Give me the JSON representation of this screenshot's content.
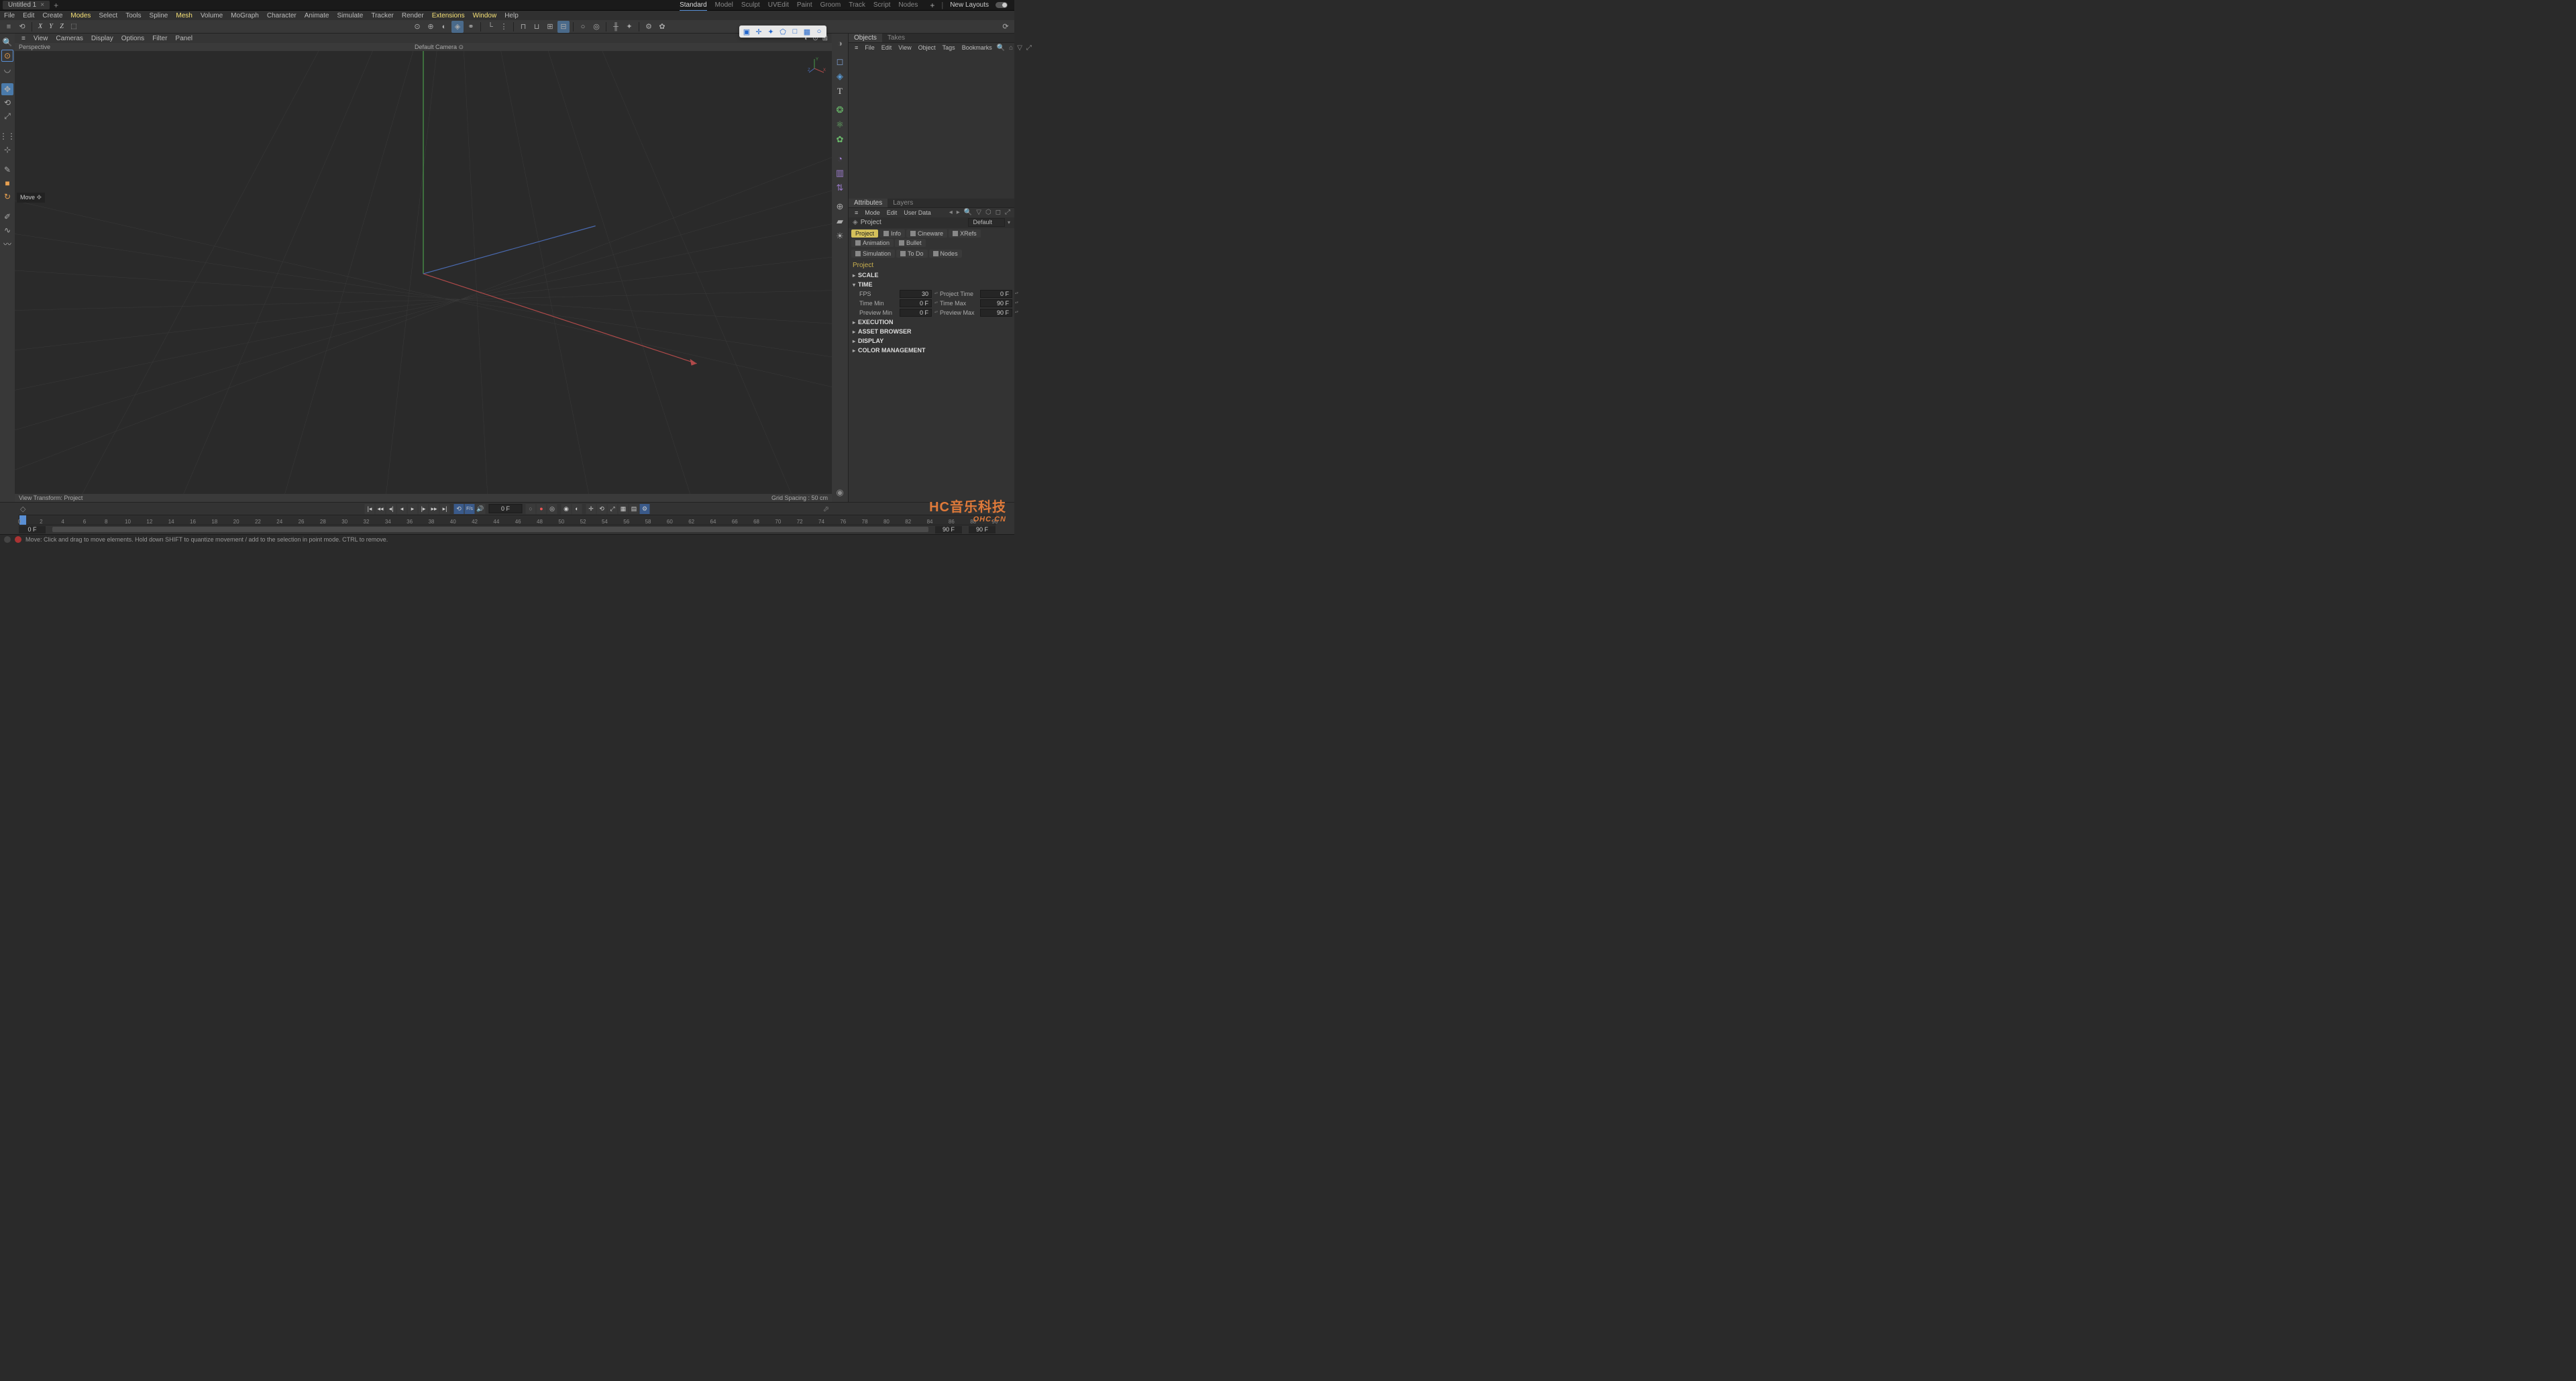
{
  "titlebar": {
    "tab_name": "Untitled 1",
    "add": "+",
    "layout_tabs": [
      "Standard",
      "Model",
      "Sculpt",
      "UVEdit",
      "Paint",
      "Groom",
      "Track",
      "Script",
      "Nodes"
    ],
    "active_layout": 0,
    "new_layouts": "New Layouts"
  },
  "menu": {
    "items": [
      "File",
      "Edit",
      "Create",
      "Modes",
      "Select",
      "Tools",
      "Spline",
      "Mesh",
      "Volume",
      "MoGraph",
      "Character",
      "Animate",
      "Simulate",
      "Tracker",
      "Render",
      "Extensions",
      "Window",
      "Help"
    ],
    "highlighted": [
      "Modes",
      "Mesh",
      "Extensions",
      "Window"
    ]
  },
  "toolbar": {
    "axes": [
      "X",
      "Y",
      "Z"
    ]
  },
  "viewport": {
    "menu": [
      "View",
      "Cameras",
      "Display",
      "Options",
      "Filter",
      "Panel"
    ],
    "label": "Perspective",
    "camera_label": "Default Camera",
    "footer_left": "View Transform: Project",
    "footer_right": "Grid Spacing : 50 cm",
    "move_tip": "Move"
  },
  "objects_panel": {
    "tabs": [
      "Objects",
      "Takes"
    ],
    "menu": [
      "File",
      "Edit",
      "View",
      "Object",
      "Tags",
      "Bookmarks"
    ]
  },
  "attributes_panel": {
    "tabs": [
      "Attributes",
      "Layers"
    ],
    "menu": [
      "Mode",
      "Edit",
      "User Data"
    ],
    "mode": "Project",
    "mode_dropdown": "Default",
    "attr_tabs": [
      "Project",
      "Info",
      "Cineware",
      "XRefs",
      "Animation",
      "Bullet"
    ],
    "attr_tabs2": [
      "Simulation",
      "To Do",
      "Nodes"
    ],
    "section_title": "Project",
    "groups": {
      "scale": "SCALE",
      "time": "TIME",
      "execution": "EXECUTION",
      "asset": "ASSET BROWSER",
      "display": "DISPLAY",
      "color": "COLOR MANAGEMENT"
    },
    "time_fields": {
      "fps_label": "FPS",
      "fps": "30",
      "proj_time_label": "Project Time",
      "proj_time": "0 F",
      "tmin_label": "Time Min",
      "tmin": "0 F",
      "tmax_label": "Time Max",
      "tmax": "90 F",
      "pmin_label": "Preview Min",
      "pmin": "0 F",
      "pmax_label": "Preview Max",
      "pmax": "90 F"
    }
  },
  "timeline": {
    "current": "0 F",
    "ruler_ticks": [
      "0",
      "2",
      "4",
      "6",
      "8",
      "10",
      "12",
      "14",
      "16",
      "18",
      "20",
      "22",
      "24",
      "26",
      "28",
      "30",
      "32",
      "34",
      "36",
      "38",
      "40",
      "42",
      "44",
      "46",
      "48",
      "50",
      "52",
      "54",
      "56",
      "58",
      "60",
      "62",
      "64",
      "66",
      "68",
      "70",
      "72",
      "74",
      "76",
      "78",
      "80",
      "82",
      "84",
      "86",
      "88",
      "90"
    ],
    "range_start": "0 F",
    "range_end": "90 F",
    "range_end2": "90 F"
  },
  "statusbar": {
    "text": "Move: Click and drag to move elements. Hold down SHIFT to quantize movement / add to the selection in point mode. CTRL to remove."
  },
  "watermark": {
    "big": "HC音乐科技",
    "small": "OHC.CN"
  }
}
